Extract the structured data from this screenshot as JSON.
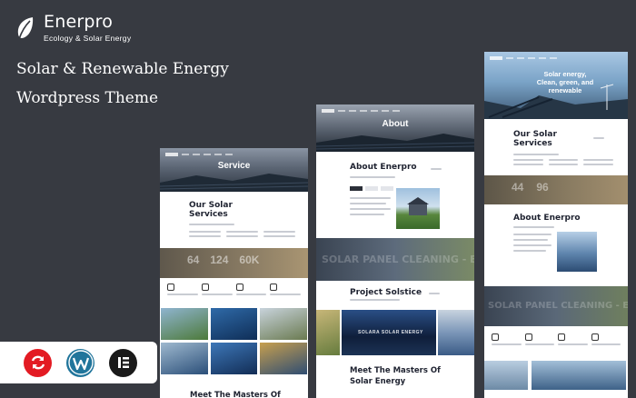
{
  "brand": {
    "name": "Enerpro",
    "tagline": "Ecology & Solar Energy",
    "logo_icon": "leaf-icon"
  },
  "headline": {
    "line1": "Solar & Renewable Energy",
    "line2": "Wordpress Theme"
  },
  "badges": [
    {
      "icon": "refresh-icon",
      "color": "#e31b23"
    },
    {
      "icon": "wordpress-icon",
      "color": "#21759b"
    },
    {
      "icon": "elementor-icon",
      "color": "#1a1a1a"
    }
  ],
  "mock_left": {
    "hero_title": "Service",
    "section_title": "Our Solar Services",
    "stats": [
      "64",
      "124",
      "60K"
    ],
    "bottom_title": "Meet The Masters Of"
  },
  "mock_center": {
    "hero_title": "About",
    "about_title": "About Enerpro",
    "banner_text": "SOLAR PANEL CLEANING - ENER",
    "project_title": "Project Solstice",
    "image_caption": "SOLARA SOLAR ENERGY",
    "bottom_title_1": "Meet The Masters Of",
    "bottom_title_2": "Solar Energy"
  },
  "mock_right": {
    "hero_line1": "Solar energy,",
    "hero_line2": "Clean, green, and",
    "hero_line3": "renewable",
    "section_title": "Our Solar Services",
    "stats": [
      "44",
      "96"
    ],
    "about_title": "About Enerpro",
    "banner_text": "SOLAR PANEL CLEANING - ENER"
  },
  "colors": {
    "background": "#373a41",
    "accent": "#c9ccd3",
    "dark_text": "#1e2230"
  }
}
